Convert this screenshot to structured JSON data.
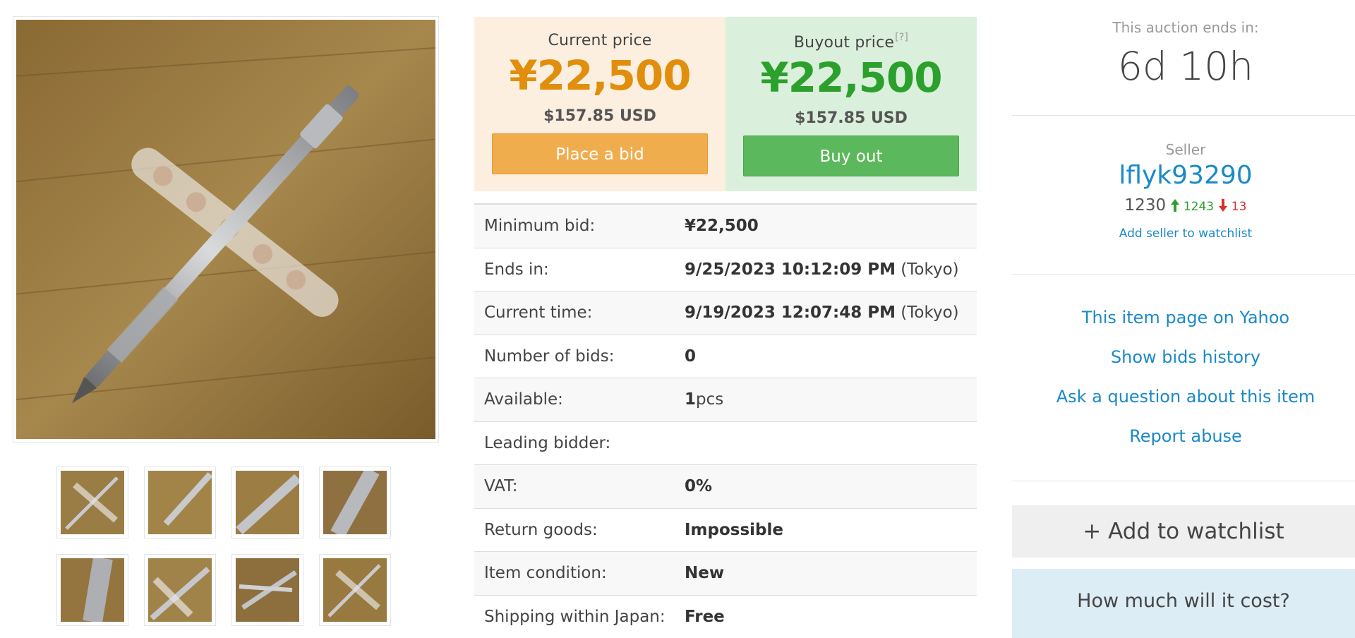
{
  "gallery": {
    "main_photo": "pencil-photo",
    "thumbnail_count": 8
  },
  "prices": {
    "current": {
      "label": "Current price",
      "amount": "¥22,500",
      "usd": "$157.85 USD",
      "button": "Place a bid"
    },
    "buyout": {
      "label": "Buyout price",
      "help_mark": "[?]",
      "amount": "¥22,500",
      "usd": "$157.85 USD",
      "button": "Buy out"
    }
  },
  "details": [
    {
      "label": "Minimum bid:",
      "value": "¥22,500",
      "suffix": ""
    },
    {
      "label": "Ends in:",
      "value": "9/25/2023 10:12:09 PM",
      "suffix": " (Tokyo)"
    },
    {
      "label": "Current time:",
      "value": "9/19/2023 12:07:48 PM",
      "suffix": " (Tokyo)"
    },
    {
      "label": "Number of bids:",
      "value": "0",
      "suffix": ""
    },
    {
      "label": "Available:",
      "value": "1",
      "suffix": "pcs"
    },
    {
      "label": "Leading bidder:",
      "value": "",
      "suffix": ""
    },
    {
      "label": "VAT:",
      "value": "0%",
      "suffix": ""
    },
    {
      "label": "Return goods:",
      "value": "Impossible",
      "suffix": ""
    },
    {
      "label": "Item condition:",
      "value": "New",
      "suffix": ""
    },
    {
      "label": "Shipping within Japan:",
      "value": "Free",
      "suffix": ""
    }
  ],
  "sidebar": {
    "ends_label": "This auction ends in:",
    "ends_value": "6d 10h",
    "seller_label": "Seller",
    "seller_name": "lflyk93290",
    "rating_total": "1230",
    "rating_positive": "1243",
    "rating_negative": "13",
    "add_seller_link": "Add seller to watchlist",
    "links": [
      "This item page on Yahoo",
      "Show bids history",
      "Ask a question about this item",
      "Report abuse"
    ],
    "watchlist_button": "+ Add to watchlist",
    "cost_title": "How much will it cost?"
  },
  "colors": {
    "current_accent": "#e08e0b",
    "buyout_accent": "#2ba02d",
    "link": "#1a8ac7",
    "bid_button": "#f0ad4e",
    "buy_button": "#5cb85c"
  }
}
